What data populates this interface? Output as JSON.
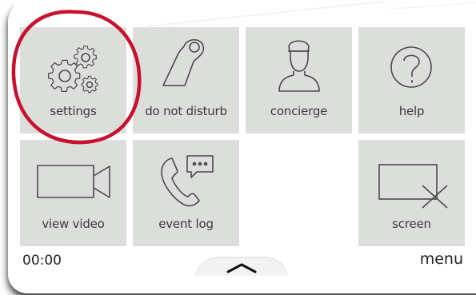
{
  "tiles": {
    "settings": {
      "label": "settings",
      "icon": "gears-icon"
    },
    "do_not_disturb": {
      "label": "do not disturb",
      "icon": "door-hanger-icon"
    },
    "concierge": {
      "label": "concierge",
      "icon": "concierge-person-icon"
    },
    "help": {
      "label": "help",
      "icon": "question-circle-icon"
    },
    "view_video": {
      "label": "view video",
      "icon": "video-camera-icon"
    },
    "event_log": {
      "label": "event log",
      "icon": "phone-chat-icon"
    },
    "screen": {
      "label": "screen",
      "icon": "screen-off-icon"
    }
  },
  "status": {
    "time": "00:00",
    "menu_label": "menu",
    "pull_tab_icon": "chevron-up-icon"
  },
  "colors": {
    "tile_bg": "#dcdedb",
    "icon_stroke": "#4a4a4a",
    "highlight_circle": "#c8102e"
  }
}
